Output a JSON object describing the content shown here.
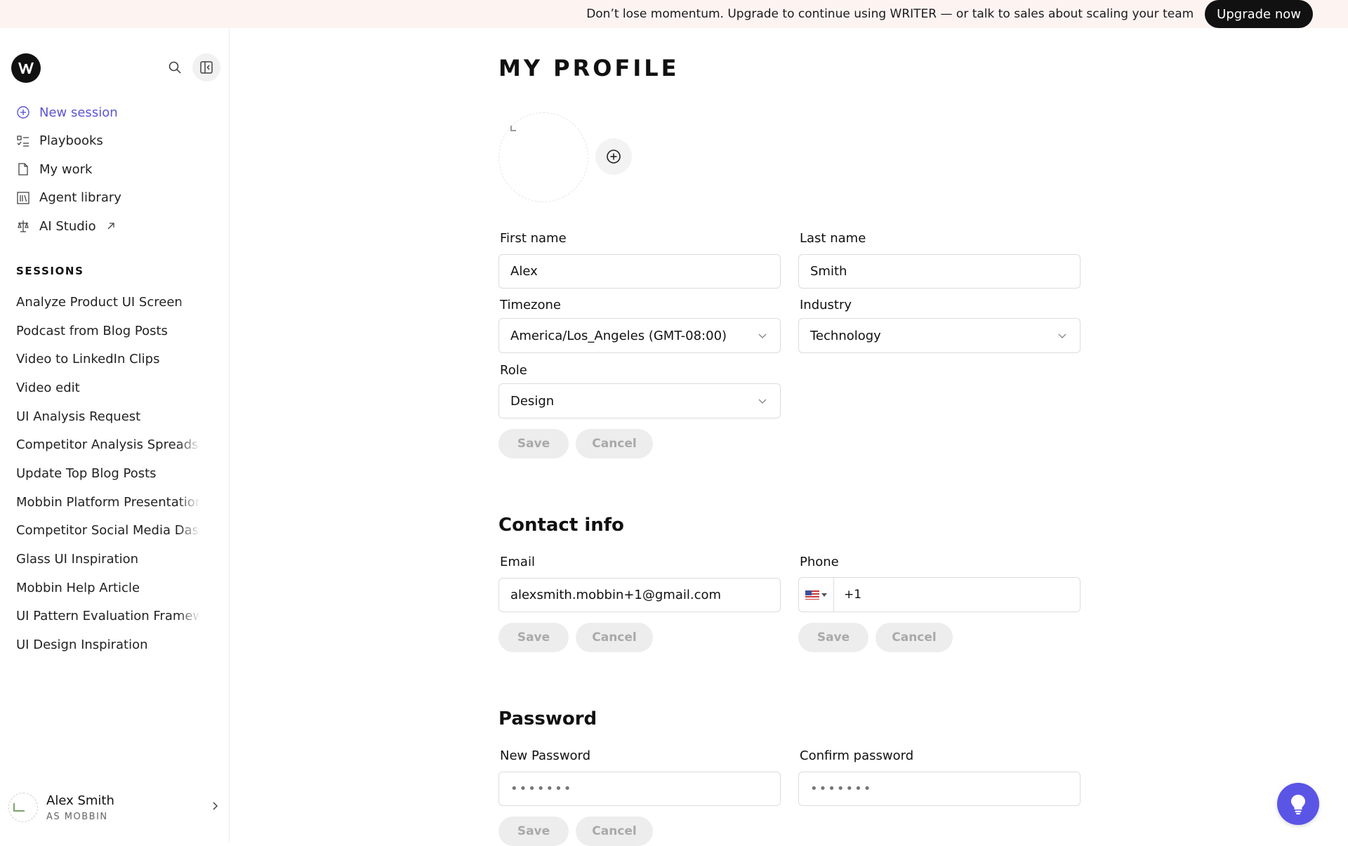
{
  "banner": {
    "text": "Don’t lose momentum. Upgrade to continue using WRITER — or talk to sales about scaling your team",
    "upgrade_label": "Upgrade now"
  },
  "sidebar": {
    "nav": [
      {
        "label": "New session",
        "icon": "plus-circle-icon",
        "active": true
      },
      {
        "label": "Playbooks",
        "icon": "checklist-icon"
      },
      {
        "label": "My work",
        "icon": "file-icon"
      },
      {
        "label": "Agent library",
        "icon": "library-icon"
      },
      {
        "label": "AI Studio",
        "icon": "studio-icon"
      }
    ],
    "sessions_title": "SESSIONS",
    "sessions": [
      "Analyze Product UI Screen",
      "Podcast from Blog Posts",
      "Video to LinkedIn Clips",
      "Video edit",
      "UI Analysis Request",
      "Competitor Analysis Spreadsheet",
      "Update Top Blog Posts",
      "Mobbin Platform Presentation",
      "Competitor Social Media Dashboard",
      "Glass UI Inspiration",
      "Mobbin Help Article",
      "UI Pattern Evaluation Framework",
      "UI Design Inspiration"
    ],
    "user": {
      "name": "Alex Smith",
      "org": "AS MOBBIN"
    }
  },
  "profile": {
    "title": "MY PROFILE",
    "first_name_label": "First name",
    "first_name_value": "Alex",
    "last_name_label": "Last name",
    "last_name_value": "Smith",
    "timezone_label": "Timezone",
    "timezone_value": "America/Los_Angeles (GMT-08:00)",
    "industry_label": "Industry",
    "industry_value": "Technology",
    "role_label": "Role",
    "role_value": "Design",
    "save_label": "Save",
    "cancel_label": "Cancel"
  },
  "contact": {
    "title": "Contact info",
    "email_label": "Email",
    "email_value": "alexsmith.mobbin+1@gmail.com",
    "phone_label": "Phone",
    "phone_code": "+1",
    "save_label": "Save",
    "cancel_label": "Cancel"
  },
  "password": {
    "title": "Password",
    "new_label": "New Password",
    "new_value": "•••••••",
    "confirm_label": "Confirm password",
    "confirm_value": "•••••••",
    "save_label": "Save",
    "cancel_label": "Cancel"
  },
  "colors": {
    "accent": "#5b55d6",
    "help_fab": "#5b55e6",
    "banner_bg": "#fdf4f2"
  }
}
